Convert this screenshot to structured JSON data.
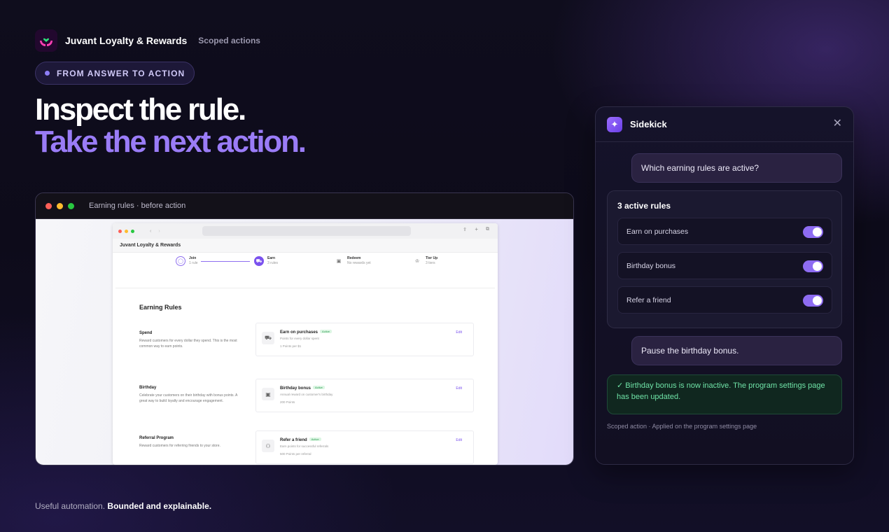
{
  "brand": {
    "name": "Juvant Loyalty & Rewards",
    "tag": "Scoped actions"
  },
  "pill": "FROM ANSWER TO ACTION",
  "headline": {
    "line1": "Inspect the rule.",
    "line2": "Take the next action."
  },
  "preview": {
    "window_title": "Earning rules · before action",
    "inner": {
      "app_title": "Juvant Loyalty & Rewards",
      "steps": [
        {
          "label": "Join",
          "sub": "1 rule"
        },
        {
          "label": "Earn",
          "sub": "3 rules"
        },
        {
          "label": "Redeem",
          "sub": "No rewards yet"
        },
        {
          "label": "Tier Up",
          "sub": "3 tiers"
        }
      ],
      "heading": "Earning Rules",
      "sections": [
        {
          "title": "Spend",
          "desc": "Reward customers for every dollar they spend. This is the most common way to earn points.",
          "card": {
            "name": "Earn on purchases",
            "badge": "Active",
            "sub": "Points for every dollar spent",
            "value": "1 Points per $1",
            "edit": "Edit"
          }
        },
        {
          "title": "Birthday",
          "desc": "Celebrate your customers on their birthday with bonus points. A great way to build loyalty and encourage engagement.",
          "card": {
            "name": "Birthday bonus",
            "badge": "Active",
            "sub": "Annual reward on customer's birthday",
            "value": "200 Points",
            "edit": "Edit"
          }
        },
        {
          "title": "Referral Program",
          "desc": "Reward customers for referring friends to your store.",
          "card": {
            "name": "Refer a friend",
            "badge": "Active",
            "sub": "Earn points for successful referrals",
            "value": "500 Points per referral",
            "edit": "Edit"
          }
        }
      ]
    }
  },
  "sidekick": {
    "title": "Sidekick",
    "question": "Which earning rules are active?",
    "answer_title": "3 active rules",
    "rules": [
      {
        "label": "Earn on purchases",
        "on": true
      },
      {
        "label": "Birthday bonus",
        "on": true
      },
      {
        "label": "Refer a friend",
        "on": true
      }
    ],
    "command": "Pause the birthday bonus.",
    "result": "✓ Birthday bonus is now inactive. The program settings page has been updated.",
    "footer": "Scoped action · Applied on the program settings page"
  },
  "tagline": {
    "plain": "Useful automation.",
    "bold": "Bounded and explainable."
  },
  "colors": {
    "accent": "#9a7cf7",
    "toggle": "#8e6cf2",
    "success": "#6fe3a7"
  }
}
